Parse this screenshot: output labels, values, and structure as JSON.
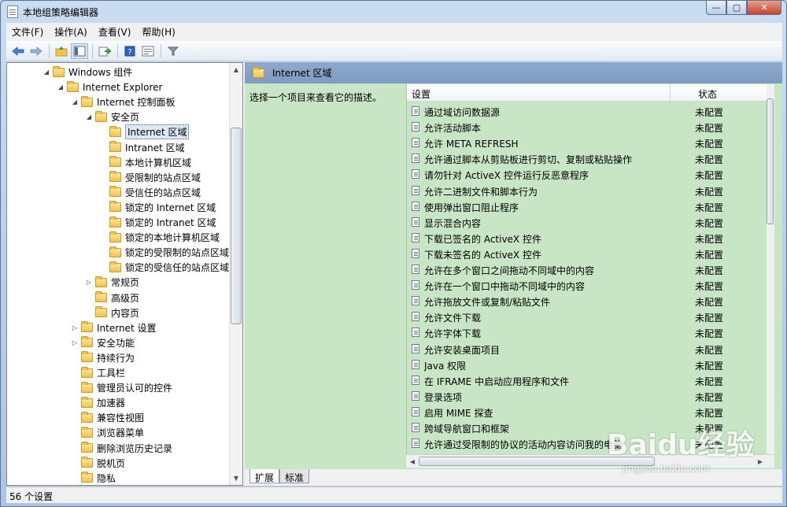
{
  "window": {
    "title": "本地组策略编辑器",
    "btn_min": "—",
    "btn_max": "▢",
    "btn_close": "✕"
  },
  "menu": [
    "文件(F)",
    "操作(A)",
    "查看(V)",
    "帮助(H)"
  ],
  "toolbar": {
    "icons": [
      "back-icon",
      "forward-icon",
      "up-folder-icon",
      "show-tree-icon",
      "export-icon",
      "help-icon",
      "properties-icon",
      "filter-icon"
    ]
  },
  "tree": {
    "nodes": [
      {
        "label": "Windows 组件",
        "arrow": "◢"
      },
      {
        "label": "Internet Explorer",
        "arrow": "◢"
      },
      {
        "label": "Internet 控制面板",
        "arrow": "◢"
      },
      {
        "label": "安全页",
        "arrow": "◢"
      },
      {
        "label": "Internet 区域",
        "arrow": "",
        "selected": true
      },
      {
        "label": "Intranet 区域",
        "arrow": ""
      },
      {
        "label": "本地计算机区域",
        "arrow": ""
      },
      {
        "label": "受限制的站点区域",
        "arrow": ""
      },
      {
        "label": "受信任的站点区域",
        "arrow": ""
      },
      {
        "label": "锁定的 Internet 区域",
        "arrow": ""
      },
      {
        "label": "锁定的 Intranet 区域",
        "arrow": ""
      },
      {
        "label": "锁定的本地计算机区域",
        "arrow": ""
      },
      {
        "label": "锁定的受限制的站点区域",
        "arrow": ""
      },
      {
        "label": "锁定的受信任的站点区域",
        "arrow": ""
      },
      {
        "label": "常规页",
        "arrow": "▷"
      },
      {
        "label": "高级页",
        "arrow": ""
      },
      {
        "label": "内容页",
        "arrow": ""
      },
      {
        "label": "Internet 设置",
        "arrow": "▷"
      },
      {
        "label": "安全功能",
        "arrow": "▷"
      },
      {
        "label": "持续行为",
        "arrow": ""
      },
      {
        "label": "工具栏",
        "arrow": ""
      },
      {
        "label": "管理员认可的控件",
        "arrow": ""
      },
      {
        "label": "加速器",
        "arrow": ""
      },
      {
        "label": "兼容性视图",
        "arrow": ""
      },
      {
        "label": "浏览器菜单",
        "arrow": ""
      },
      {
        "label": "删除浏览历史记录",
        "arrow": ""
      },
      {
        "label": "脱机页",
        "arrow": ""
      },
      {
        "label": "隐私",
        "arrow": ""
      }
    ]
  },
  "right": {
    "header": "Internet 区域",
    "description": "选择一个项目来查看它的描述。",
    "col_setting": "设置",
    "col_state": "状态",
    "rows": [
      {
        "name": "通过域访问数据源",
        "state": "未配置"
      },
      {
        "name": "允许活动脚本",
        "state": "未配置"
      },
      {
        "name": "允许 META REFRESH",
        "state": "未配置"
      },
      {
        "name": "允许通过脚本从剪贴板进行剪切、复制或粘贴操作",
        "state": "未配置"
      },
      {
        "name": "请勿针对 ActiveX 控件运行反恶意程序",
        "state": "未配置"
      },
      {
        "name": "允许二进制文件和脚本行为",
        "state": "未配置"
      },
      {
        "name": "使用弹出窗口阻止程序",
        "state": "未配置"
      },
      {
        "name": "显示混合内容",
        "state": "未配置"
      },
      {
        "name": "下载已签名的 ActiveX 控件",
        "state": "未配置"
      },
      {
        "name": "下载未签名的 ActiveX 控件",
        "state": "未配置"
      },
      {
        "name": "允许在多个窗口之间拖动不同域中的内容",
        "state": "未配置"
      },
      {
        "name": "允许在一个窗口中拖动不同域中的内容",
        "state": "未配置"
      },
      {
        "name": "允许拖放文件或复制/粘贴文件",
        "state": "未配置"
      },
      {
        "name": "允许文件下载",
        "state": "未配置"
      },
      {
        "name": "允许字体下载",
        "state": "未配置"
      },
      {
        "name": "允许安装桌面项目",
        "state": "未配置"
      },
      {
        "name": "Java 权限",
        "state": "未配置"
      },
      {
        "name": "在 IFRAME 中启动应用程序和文件",
        "state": "未配置"
      },
      {
        "name": "登录选项",
        "state": "未配置"
      },
      {
        "name": "启用 MIME 探查",
        "state": "未配置"
      },
      {
        "name": "跨域导航窗口和框架",
        "state": "未配置"
      },
      {
        "name": "允许通过受限制的协议的活动内容访问我的电脑",
        "state": "未配置"
      }
    ],
    "tabs": [
      "扩展",
      "标准"
    ]
  },
  "status": "56 个设置",
  "watermark": {
    "brand": "Baidu经验",
    "url": "jingyan.baidu.com"
  }
}
